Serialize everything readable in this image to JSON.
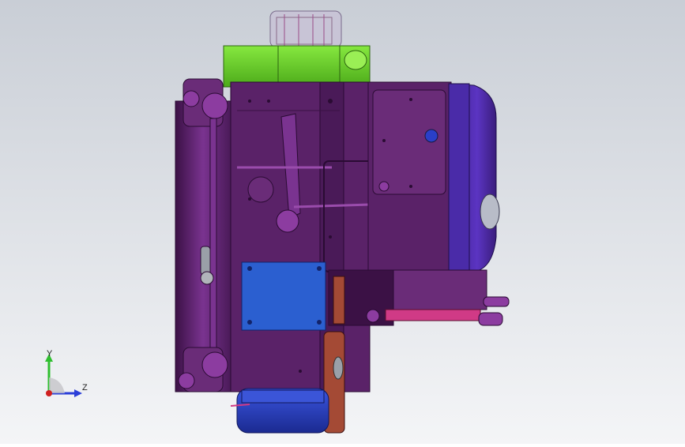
{
  "viewport": {
    "background_top": "#c9ced6",
    "background_bottom": "#f4f5f7"
  },
  "model": {
    "icon": "cad-assembly-model",
    "colors": {
      "frame": "#6a2c78",
      "frame_dark": "#3b1145",
      "motor_cover": "#5a2fb8",
      "top_block": "#6bd12a",
      "blue_panel": "#2b5fd0",
      "bottom_tank": "#2a3fc8",
      "copper": "#a44a35",
      "pink_rail": "#d03a86"
    }
  },
  "triad": {
    "icon": "coordinate-triad-icon",
    "y_label": "Y",
    "z_label": "Z",
    "colors": {
      "y": "#2fbf2f",
      "z": "#2b3fd8",
      "origin": "#d02020"
    }
  }
}
